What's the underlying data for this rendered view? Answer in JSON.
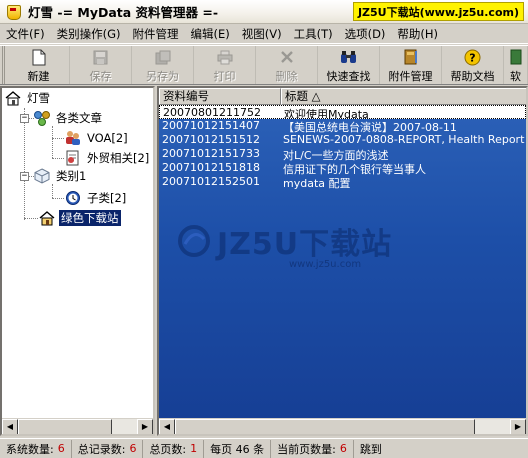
{
  "window": {
    "app_name": "灯雪",
    "title": "-= MyData 资料管理器 =-",
    "watermark": "JZ5U下载站(www.jz5u.com)"
  },
  "menu": [
    {
      "label": "文件(F)"
    },
    {
      "label": "类别操作(G)"
    },
    {
      "label": "附件管理"
    },
    {
      "label": "编辑(E)"
    },
    {
      "label": "视图(V)"
    },
    {
      "label": "工具(T)"
    },
    {
      "label": "选项(D)"
    },
    {
      "label": "帮助(H)"
    }
  ],
  "toolbar": [
    {
      "label": "新建",
      "icon": "new-document-icon",
      "enabled": true
    },
    {
      "label": "保存",
      "icon": "save-icon",
      "enabled": false
    },
    {
      "label": "另存为",
      "icon": "save-as-icon",
      "enabled": false
    },
    {
      "label": "打印",
      "icon": "print-icon",
      "enabled": false
    },
    {
      "label": "删除",
      "icon": "delete-icon",
      "enabled": false
    },
    {
      "label": "快速查找",
      "icon": "binoculars-icon",
      "enabled": true
    },
    {
      "label": "附件管理",
      "icon": "attachment-book-icon",
      "enabled": true
    },
    {
      "label": "帮助文档",
      "icon": "help-icon",
      "enabled": true
    },
    {
      "label": "软",
      "icon": "software-icon",
      "enabled": true
    }
  ],
  "tree": {
    "root": "灯雪",
    "cat1": "各类文章",
    "cat1_child1": "VOA[2]",
    "cat1_child2": "外贸相关[2]",
    "cat2": "类别1",
    "cat2_child1": "子类[2]",
    "cat3": "绿色下载站"
  },
  "list": {
    "columns": [
      "资料编号",
      "标题 △"
    ],
    "rows": [
      {
        "id": "20070801211752",
        "title": "欢迎使用Mydata"
      },
      {
        "id": "20071012151407",
        "title": "【美国总统电台演说】2007-08-11"
      },
      {
        "id": "20071012151512",
        "title": "SENEWS-2007-0808-REPORT, Health Report"
      },
      {
        "id": "20071012151733",
        "title": "对L/C一些方面的浅述"
      },
      {
        "id": "20071012151818",
        "title": "信用证下的几个银行等当事人"
      },
      {
        "id": "20071012152501",
        "title": "mydata 配置"
      }
    ],
    "watermark_logo": "JZ5U下载站",
    "watermark_url": "www.jz5u.com"
  },
  "status": [
    {
      "label": "系统数量:",
      "value": "6"
    },
    {
      "label": "总记录数:",
      "value": "6"
    },
    {
      "label": "总页数:",
      "value": "1"
    },
    {
      "label": "每页 46 条",
      "value": ""
    },
    {
      "label": "当前页数量:",
      "value": "6"
    },
    {
      "label": "跳到",
      "value": ""
    }
  ],
  "colors": {
    "selection": "#1d4fa8",
    "tree_selected": "#0a246a",
    "status_value": "#c00000",
    "watermark_bg": "#fff200"
  }
}
